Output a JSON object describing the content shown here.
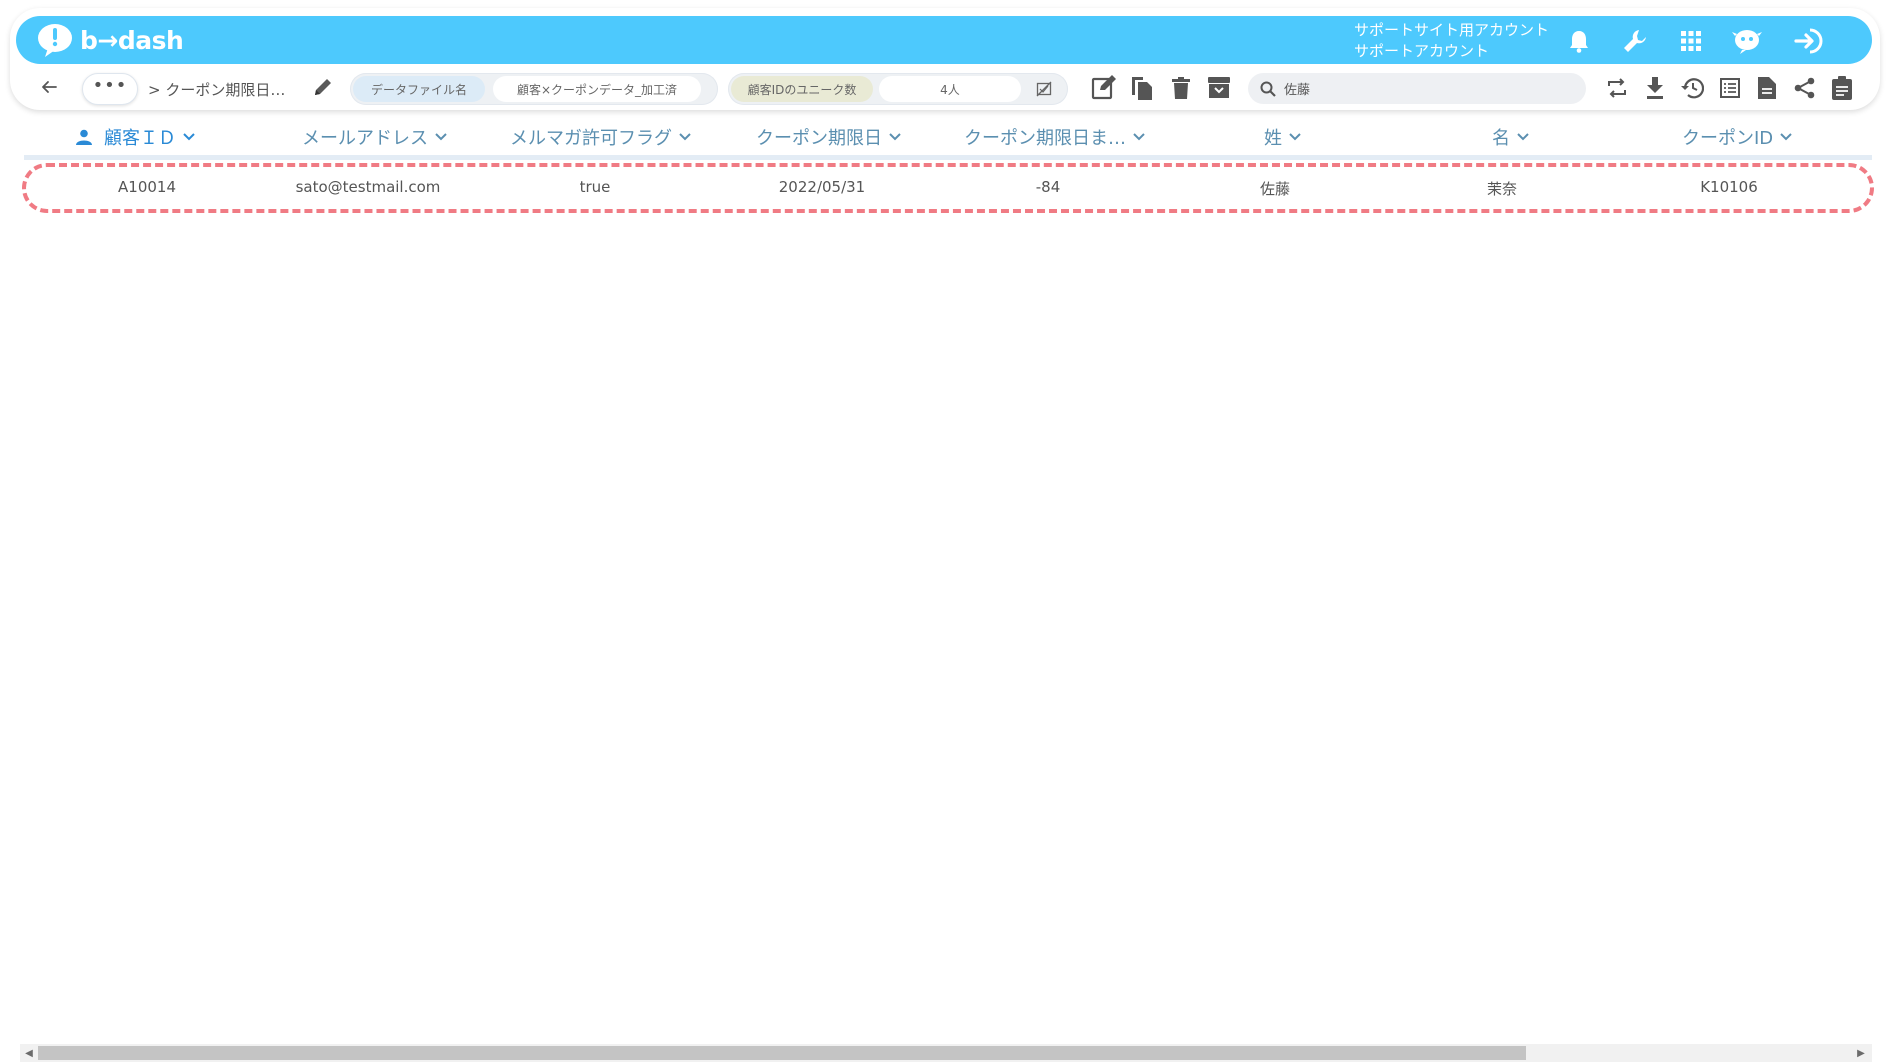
{
  "app": {
    "logo_text": "b→dash",
    "account_line1": "サポートサイト用アカウント",
    "account_line2": "サポートアカウント",
    "brand_color": "#4dc9fd"
  },
  "topbar_icons": [
    "bell-icon",
    "wrench-icon",
    "grid-icon",
    "chat-bird-icon",
    "logout-icon"
  ],
  "toolbar": {
    "more_label": "•••",
    "breadcrumb": "> クーポン期限日…",
    "datafile_label": "データファイル名",
    "datafile_value": "顧客×クーポンデータ_加工済",
    "unique_label": "顧客IDのユニーク数",
    "unique_value": "4人",
    "search_placeholder": "佐藤",
    "search_value": "佐藤"
  },
  "table": {
    "columns": [
      "顧客ＩＤ",
      "メールアドレス",
      "メルマガ許可フラグ",
      "クーポン期限日",
      "クーポン期限日ま…",
      "姓",
      "名",
      "クーポンID"
    ],
    "rows": [
      [
        "A10014",
        "sato@testmail.com",
        "true",
        "2022/05/31",
        "-84",
        "佐藤",
        "茉奈",
        "K10106"
      ]
    ]
  },
  "colors": {
    "header_blue": "#4dc9fd",
    "highlight_dash": "#f07b84",
    "column_text": "#5b8fb0",
    "active_column": "#2a8ad6",
    "datafile_pill": "#dcebf7",
    "unique_pill": "#e9ead5"
  }
}
